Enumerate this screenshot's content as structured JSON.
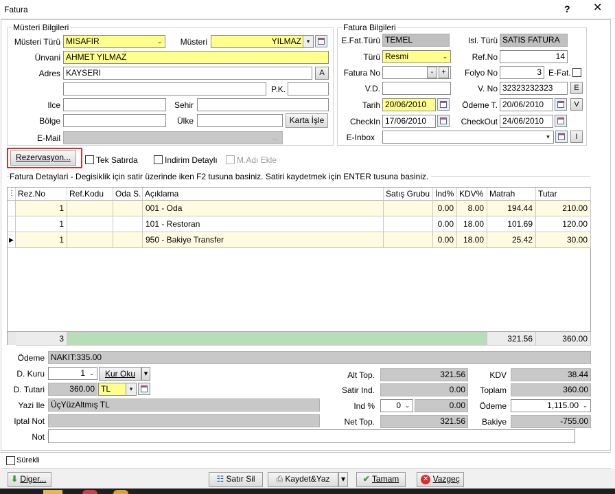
{
  "window": {
    "title": "Fatura",
    "help": "?",
    "close": "✕"
  },
  "musteri": {
    "group_title": "Müsteri Bilgileri",
    "musteri_turu_label": "Müsteri Türü",
    "musteri_turu": "MISAFIR",
    "musteri_label": "Müsteri",
    "musteri": "YILMAZ",
    "unvani_label": "Ünvani",
    "unvani": "AHMET YILMAZ",
    "adres_label": "Adres",
    "adres": "KAYSERI",
    "adres_btn": "A",
    "pk_label": "P.K.",
    "ilce_label": "Ilce",
    "sehir_label": "Sehir",
    "bolge_label": "Bölge",
    "ulke_label": "Ülke",
    "karta_isle": "Karta İşle",
    "email_label": "E-Mail",
    "email_btn": "..."
  },
  "fatura": {
    "group_title": "Fatura Bilgileri",
    "efat_turu_label": "E.Fat.Türü",
    "efat_turu": "TEMEL",
    "isl_turu_label": "Isl. Türü",
    "isl_turu": "SATIS FATURA",
    "turu_label": "Türü",
    "turu": "Resmi",
    "ref_no_label": "Ref.No",
    "ref_no": "14",
    "fatura_no_label": "Fatura No",
    "minus": "-",
    "plus": "+",
    "folyo_no_label": "Folyo No",
    "folyo_no": "3",
    "efat_label": "E-Fat.",
    "vd_label": "V.D.",
    "vno_label": "V. No",
    "vno": "32323232323",
    "vno_btn": "E",
    "tarih_label": "Tarih",
    "tarih": "20/06/2010",
    "odeme_t_label": "Ödeme T.",
    "odeme_t": "20/06/2010",
    "odeme_btn": "V",
    "checkin_label": "CheckIn",
    "checkin": "17/06/2010",
    "checkout_label": "CheckOut",
    "checkout": "24/06/2010",
    "einbox_label": "E-Inbox",
    "einbox_btn": "I"
  },
  "options": {
    "rezervasyon": "Rezervasyon...",
    "tek_satirda": "Tek Satırda",
    "indirim_detayli": "Indirim Detaylı",
    "madi_ekle": "M.Adı Ekle"
  },
  "detail": {
    "hint": "Fatura Detaylari - Degisiklik için satir üzerinde iken F2 tusuna basiniz. Satiri kaydetmek için ENTER tusuna basiniz.",
    "columns": [
      "Rez.No",
      "Ref.Kodu",
      "Oda S.",
      "Açıklama",
      "Satış Grubu",
      "İnd%",
      "KDV%",
      "Matrah",
      "Tutar"
    ],
    "rows": [
      {
        "rez": "1",
        "ref": "",
        "oda": "",
        "aciklama": "001 - Oda",
        "grup": "",
        "ind": "0.00",
        "kdv": "8.00",
        "matrah": "194.44",
        "tutar": "210.00"
      },
      {
        "rez": "1",
        "ref": "",
        "oda": "",
        "aciklama": "101 - Restoran",
        "grup": "",
        "ind": "0.00",
        "kdv": "18.00",
        "matrah": "101.69",
        "tutar": "120.00"
      },
      {
        "rez": "1",
        "ref": "",
        "oda": "",
        "aciklama": "950 - Bakiye Transfer",
        "grup": "",
        "ind": "0.00",
        "kdv": "18.00",
        "matrah": "25.42",
        "tutar": "30.00"
      }
    ],
    "footer": {
      "count": "3",
      "matrah": "321.56",
      "tutar": "360.00"
    }
  },
  "summary": {
    "odeme_label": "Ödeme",
    "odeme": "NAKIT:335.00",
    "d_kuru_label": "D. Kuru",
    "d_kuru": "1",
    "kur_oku": "Kur Oku",
    "d_tutari_label": "D. Tutari",
    "d_tutari": "360.00",
    "currency": "TL",
    "yazi_ile_label": "Yazi Ile",
    "yazi_ile": "ÜçYüzAltmış TL",
    "iptal_not_label": "Iptal Not",
    "not_label": "Not",
    "alt_top_label": "Alt Top.",
    "alt_top": "321.56",
    "satir_ind_label": "Satir Ind.",
    "satir_ind": "0.00",
    "ind_pct_label": "Ind %",
    "ind_pct": "0",
    "ind_amount": "0.00",
    "net_top_label": "Net Top.",
    "net_top": "321.56",
    "kdv_label": "KDV",
    "kdv": "38.44",
    "toplam_label": "Toplam",
    "toplam": "360.00",
    "odeme2_label": "Ödeme",
    "odeme2": "1,115.00",
    "bakiye_label": "Bakiye",
    "bakiye": "-755.00"
  },
  "footer_bar": {
    "surekli": "Sürekli",
    "diger": "Diger...",
    "satir_sil": "Satır Sil",
    "kaydet_yaz": "Kaydet&Yaz",
    "tamam": "Tamam",
    "vazgec": "Vazgeç"
  },
  "colors": {
    "required": "#ffff8c",
    "disabled": "#c8c8c8",
    "total_bar": "#b9dcb9",
    "row_alt": "#fffbe0",
    "highlight": "#d32f2f"
  }
}
